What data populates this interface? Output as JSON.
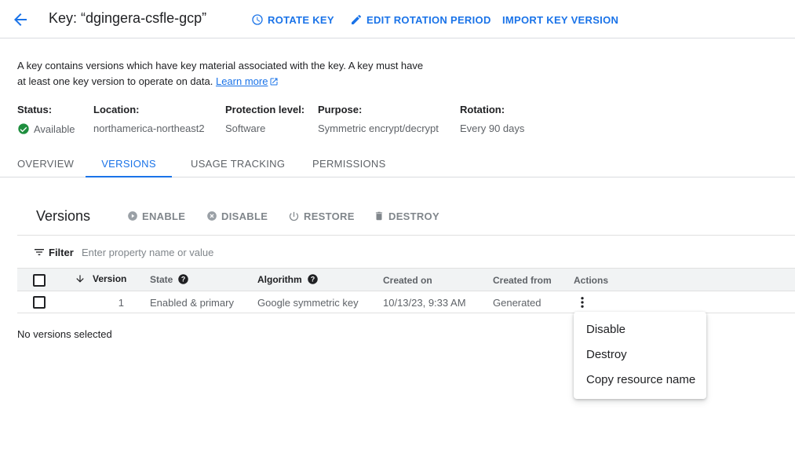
{
  "header": {
    "title": "Key: “dgingera-csfle-gcp”",
    "actions": {
      "rotate_key": "ROTATE KEY",
      "edit_rotation_period": "EDIT ROTATION PERIOD",
      "import_key_version": "IMPORT KEY VERSION"
    }
  },
  "description": {
    "text": "A key contains versions which have key material associated with the key. A key must have at least one key version to operate on data.",
    "learn_more": "Learn more"
  },
  "metadata": {
    "status": {
      "label": "Status:",
      "value": "Available"
    },
    "location": {
      "label": "Location:",
      "value": "northamerica-northeast2"
    },
    "protection_level": {
      "label": "Protection level:",
      "value": "Software"
    },
    "purpose": {
      "label": "Purpose:",
      "value": "Symmetric encrypt/decrypt"
    },
    "rotation": {
      "label": "Rotation:",
      "value": "Every 90 days"
    }
  },
  "tabs": [
    {
      "label": "OVERVIEW",
      "active": false
    },
    {
      "label": "VERSIONS",
      "active": true
    },
    {
      "label": "USAGE TRACKING",
      "active": false
    },
    {
      "label": "PERMISSIONS",
      "active": false
    }
  ],
  "versions": {
    "title": "Versions",
    "toolbar": {
      "enable": "ENABLE",
      "disable": "DISABLE",
      "restore": "RESTORE",
      "destroy": "DESTROY"
    },
    "filter": {
      "label": "Filter",
      "placeholder": "Enter property name or value"
    },
    "columns": {
      "version": "Version",
      "state": "State",
      "algorithm": "Algorithm",
      "created_on": "Created on",
      "created_from": "Created from",
      "actions": "Actions"
    },
    "rows": [
      {
        "version": "1",
        "state": "Enabled & primary",
        "algorithm": "Google symmetric key",
        "created_on": "10/13/23, 9:33 AM",
        "created_from": "Generated"
      }
    ],
    "selection_status": "No versions selected"
  },
  "actions_menu": {
    "items": [
      "Disable",
      "Destroy",
      "Copy resource name"
    ]
  },
  "colors": {
    "accent": "#1a73e8",
    "success": "#1e8e3e",
    "disabled": "#80868b"
  }
}
